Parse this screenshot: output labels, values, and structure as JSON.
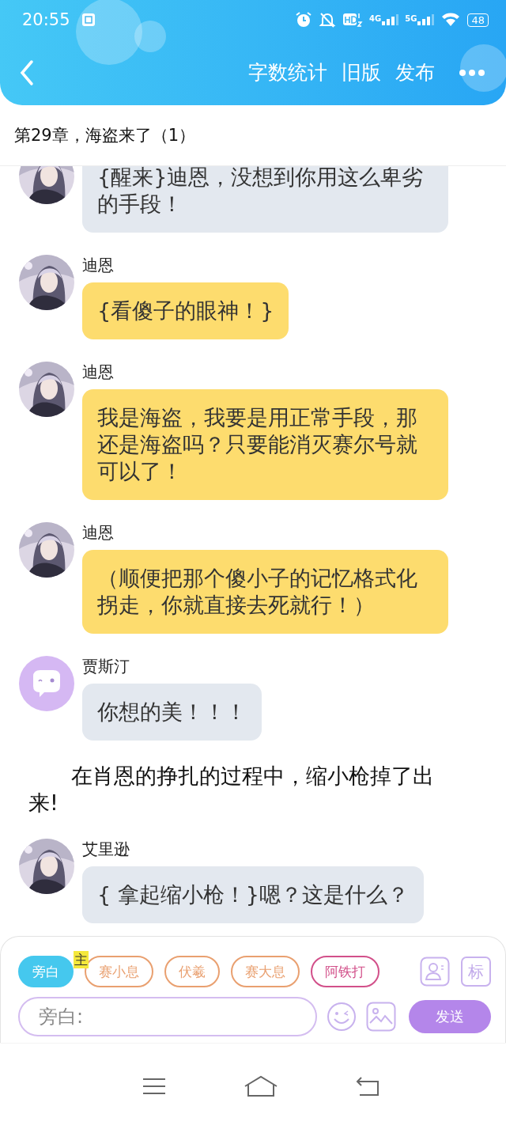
{
  "status_bar": {
    "time": "20:55",
    "network": [
      "4G",
      "5G"
    ],
    "battery": "48"
  },
  "header": {
    "actions": [
      "字数统计",
      "旧版",
      "发布"
    ]
  },
  "chapter_title": "第29章，海盗来了（1）",
  "messages": [
    {
      "kind": "bubble",
      "color": "#e3e8ef",
      "text": "{醒来}迪恩，没想到你用这么卑劣的手段！"
    },
    {
      "kind": "bubble",
      "color": "#fddc6e",
      "name": "迪恩",
      "text": "{看傻子的眼神！}"
    },
    {
      "kind": "bubble",
      "color": "#fddc6e",
      "name": "迪恩",
      "text": "我是海盗，我要是用正常手段，那还是海盗吗？只要能消灭赛尔号就可以了！"
    },
    {
      "kind": "bubble",
      "color": "#fddc6e",
      "name": "迪恩",
      "text": "（顺便把那个傻小子的记忆格式化拐走，你就直接去死就行！）"
    },
    {
      "kind": "bubble",
      "color": "#e3e8ef",
      "avatar": {
        "kind": "default"
      },
      "name": "贾斯汀",
      "text": "你想的美！！！"
    },
    {
      "kind": "narration",
      "text": "在肖恩的挣扎的过程中，缩小枪掉了出来!"
    },
    {
      "kind": "bubble",
      "color": "#e3e8ef",
      "name": "艾里逊",
      "text": "{ 拿起缩小枪！}嗯？这是什么？"
    }
  ],
  "characters": [
    {
      "label": "旁白",
      "selected": true,
      "color": "#45c8ee"
    },
    {
      "label": "赛小息",
      "selected": false,
      "color": "#e9a070",
      "badge": "主"
    },
    {
      "label": "伏羲",
      "selected": false,
      "color": "#e9a070"
    },
    {
      "label": "赛大息",
      "selected": false,
      "color": "#e9a070"
    },
    {
      "label": "阿铁打",
      "selected": false,
      "color": "#d2508a"
    }
  ],
  "tag_button": "标",
  "input": {
    "placeholder": "旁白:"
  },
  "send_button": "发送"
}
